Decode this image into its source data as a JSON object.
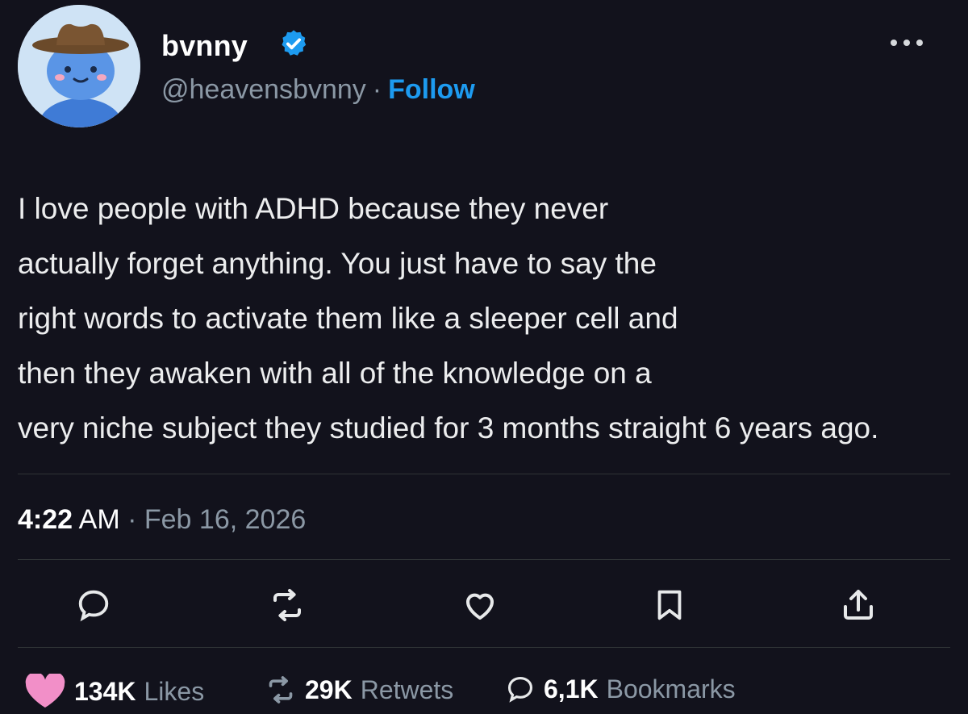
{
  "author": {
    "display_name": "bvnny",
    "handle": "@heavensbvnny",
    "separator": "·",
    "follow_label": "Follow",
    "verified_color": "#1d9bf0",
    "avatar_icon": "cowboy-hat-character-avatar"
  },
  "tweet": {
    "lines": [
      "I love people with ADHD because they never",
      "actually forget anything. You just have to say the",
      "right words to activate them like a sleeper cell and",
      "then they awaken with all of the knowledge on a",
      "very niche subject they studied for 3 months straight 6 years ago."
    ]
  },
  "meta": {
    "time": "4:22",
    "ampm": "AM",
    "separator": "·",
    "date": "Feb 16, 2026"
  },
  "actions": {
    "reply_icon": "reply-icon",
    "retweet_icon": "retweet-icon",
    "like_icon": "heart-icon",
    "bookmark_icon": "bookmark-icon",
    "share_icon": "share-icon"
  },
  "stats": {
    "likes_count": "134K",
    "likes_label": "Likes",
    "retweets_count": "29K",
    "retweets_label": "Retwets",
    "bookmarks_count": "6,1K",
    "bookmarks_label": "Bookmarks",
    "likes_heart_color": "#f28fc8"
  },
  "colors": {
    "background": "#12121c",
    "accent": "#1d9bf0",
    "muted": "#8b98a5"
  }
}
